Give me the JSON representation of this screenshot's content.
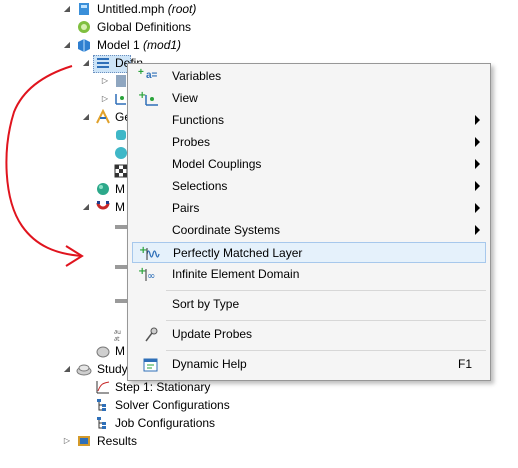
{
  "tree": {
    "root": {
      "name": "Untitled.mph",
      "tag": "(root)"
    },
    "global_definitions": "Global Definitions",
    "model": {
      "name": "Model 1",
      "tag": "(mod1)"
    },
    "definitions_partial": "Defin",
    "geometry_partial": "Ge",
    "materials_partial": "M",
    "physics_partial": "M",
    "mesh_partial": "M",
    "study": "Study",
    "step1": "Step 1: Stationary",
    "solver_configurations": "Solver Configurations",
    "job_configurations": "Job Configurations",
    "results": "Results"
  },
  "menu": {
    "variables": "Variables",
    "view": "View",
    "functions": "Functions",
    "probes": "Probes",
    "model_couplings": "Model Couplings",
    "selections": "Selections",
    "pairs": "Pairs",
    "coordinate_systems": "Coordinate Systems",
    "perfectly_matched_layer": "Perfectly Matched Layer",
    "infinite_element_domain": "Infinite Element Domain",
    "sort_by_type": "Sort by Type",
    "update_probes": "Update Probes",
    "dynamic_help": "Dynamic Help",
    "dynamic_help_shortcut": "F1",
    "variables_icon_text": "a="
  },
  "colors": {
    "annotation": "#e0141e",
    "highlight": "#e5f1fb",
    "highlight_border": "#a7c8ec"
  }
}
